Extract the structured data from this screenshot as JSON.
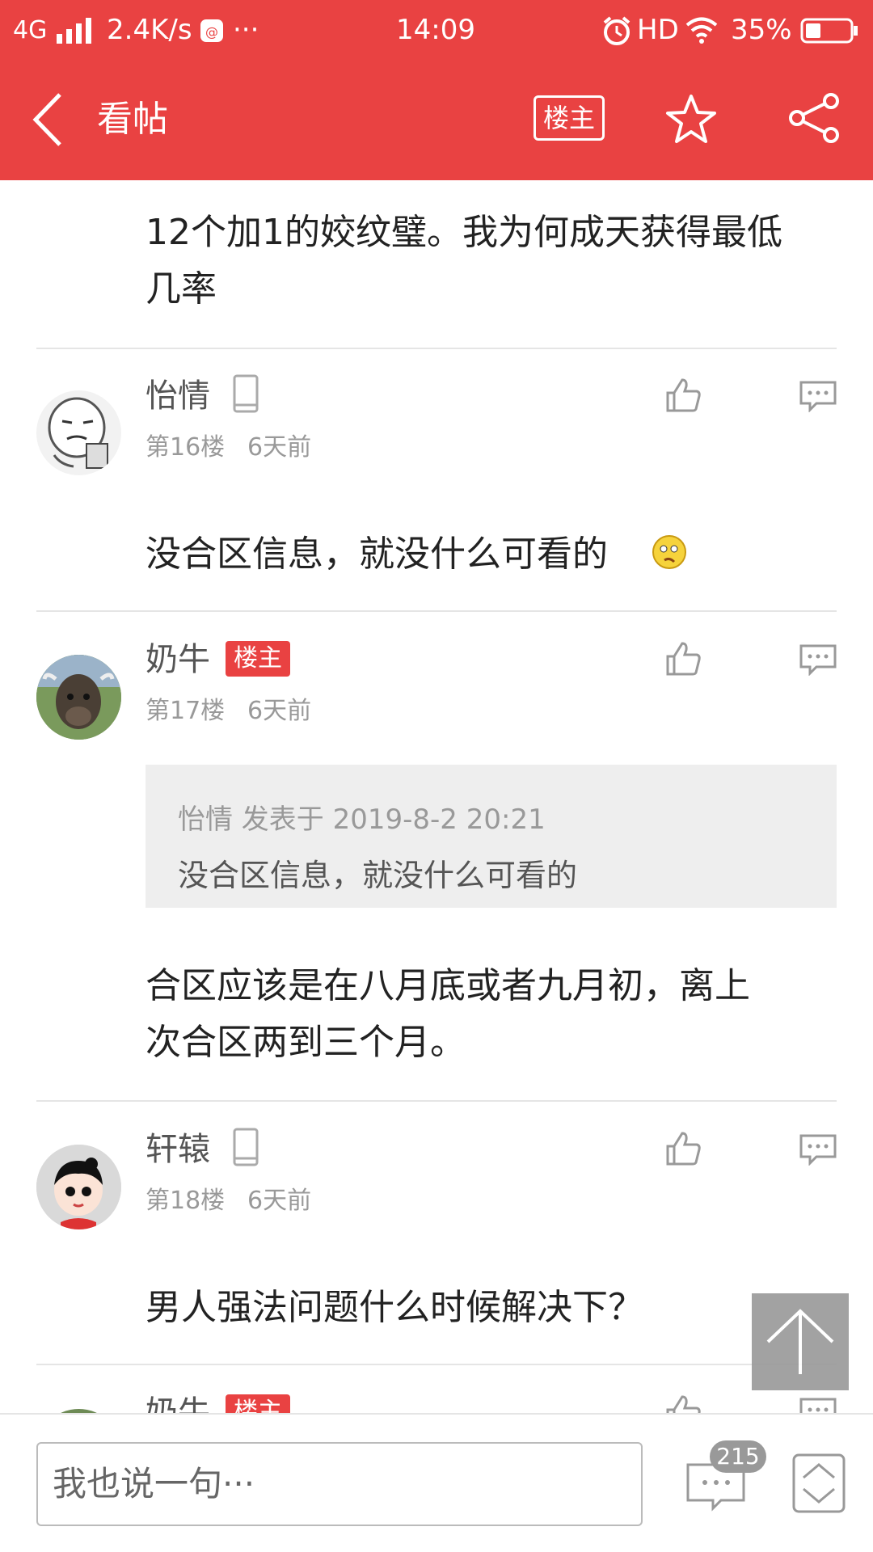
{
  "status": {
    "signal": "4G",
    "speed": "2.4K/s",
    "dots": "···",
    "time": "14:09",
    "hd": "HD",
    "battery": "35%"
  },
  "header": {
    "title": "看帖",
    "lz_button": "楼主"
  },
  "posts": [
    {
      "partial_text_line1": "12个加1的姣纹璧。我为何成天获得最低",
      "partial_text_line2": "几率"
    },
    {
      "username": "怡情",
      "floor": "第16楼",
      "time": "6天前",
      "text": "没合区信息，就没什么可看的"
    },
    {
      "username": "奶牛",
      "badge": "楼主",
      "floor": "第17楼",
      "time": "6天前",
      "quote_meta": "怡情 发表于 2019-8-2 20:21",
      "quote_text": "没合区信息，就没什么可看的",
      "text_line1": "合区应该是在八月底或者九月初，离上",
      "text_line2": "次合区两到三个月。"
    },
    {
      "username": "轩辕",
      "floor": "第18楼",
      "time": "6天前",
      "text": "男人强法问题什么时候解决下？"
    },
    {
      "username": "奶牛",
      "badge": "楼主"
    }
  ],
  "bottom": {
    "reply_placeholder": "我也说一句···",
    "comment_count": "215"
  }
}
